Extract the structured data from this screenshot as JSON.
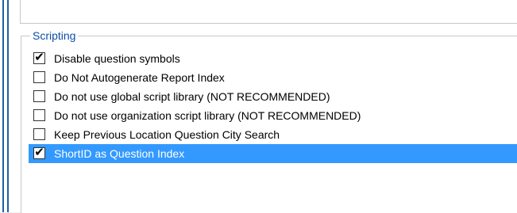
{
  "group": {
    "title": "Scripting"
  },
  "options": [
    {
      "label": "Disable question symbols",
      "checked": true,
      "selected": false
    },
    {
      "label": "Do Not Autogenerate Report Index",
      "checked": false,
      "selected": false
    },
    {
      "label": "Do not use global script library (NOT RECOMMENDED)",
      "checked": false,
      "selected": false
    },
    {
      "label": "Do not use organization script library (NOT RECOMMENDED)",
      "checked": false,
      "selected": false
    },
    {
      "label": "Keep Previous Location Question City Search",
      "checked": false,
      "selected": false
    },
    {
      "label": "ShortID as Question Index",
      "checked": true,
      "selected": true
    }
  ],
  "colors": {
    "selection": "#3399ff",
    "legend_text": "#0b4fa6",
    "window_border": "#1c5fa8"
  }
}
